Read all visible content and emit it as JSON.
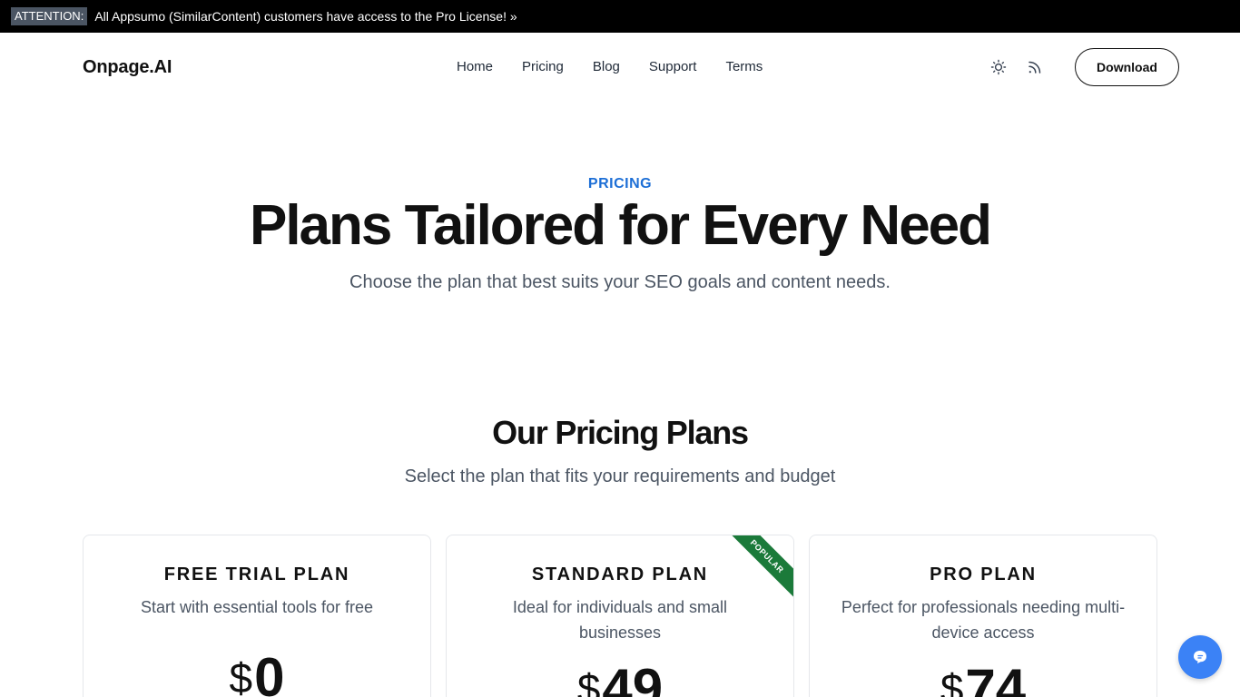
{
  "banner": {
    "tag": "ATTENTION:",
    "text": "All Appsumo (SimilarContent) customers have access to the Pro License! »"
  },
  "header": {
    "logo": "Onpage.AI",
    "nav": [
      "Home",
      "Pricing",
      "Blog",
      "Support",
      "Terms"
    ],
    "download_label": "Download",
    "icons": [
      "sun-icon",
      "rss-icon"
    ]
  },
  "hero": {
    "eyebrow": "PRICING",
    "title": "Plans Tailored for Every Need",
    "subtitle": "Choose the plan that best suits your SEO goals and content needs."
  },
  "plans_section": {
    "title": "Our Pricing Plans",
    "subtitle": "Select the plan that fits your requirements and budget"
  },
  "plans": [
    {
      "name": "FREE TRIAL PLAN",
      "desc": "Start with essential tools for free",
      "currency": "$",
      "amount": "0"
    },
    {
      "name": "STANDARD PLAN",
      "desc": "Ideal for individuals and small businesses",
      "currency": "$",
      "amount": "49",
      "badge": "POPULAR"
    },
    {
      "name": "PRO PLAN",
      "desc": "Perfect for professionals needing multi-device access",
      "currency": "$",
      "amount": "74"
    }
  ],
  "colors": {
    "accent": "#1d6fd6",
    "ribbon": "#1b7a3a",
    "chat": "#3b82f6"
  },
  "chat": {
    "icon": "chat-icon"
  }
}
